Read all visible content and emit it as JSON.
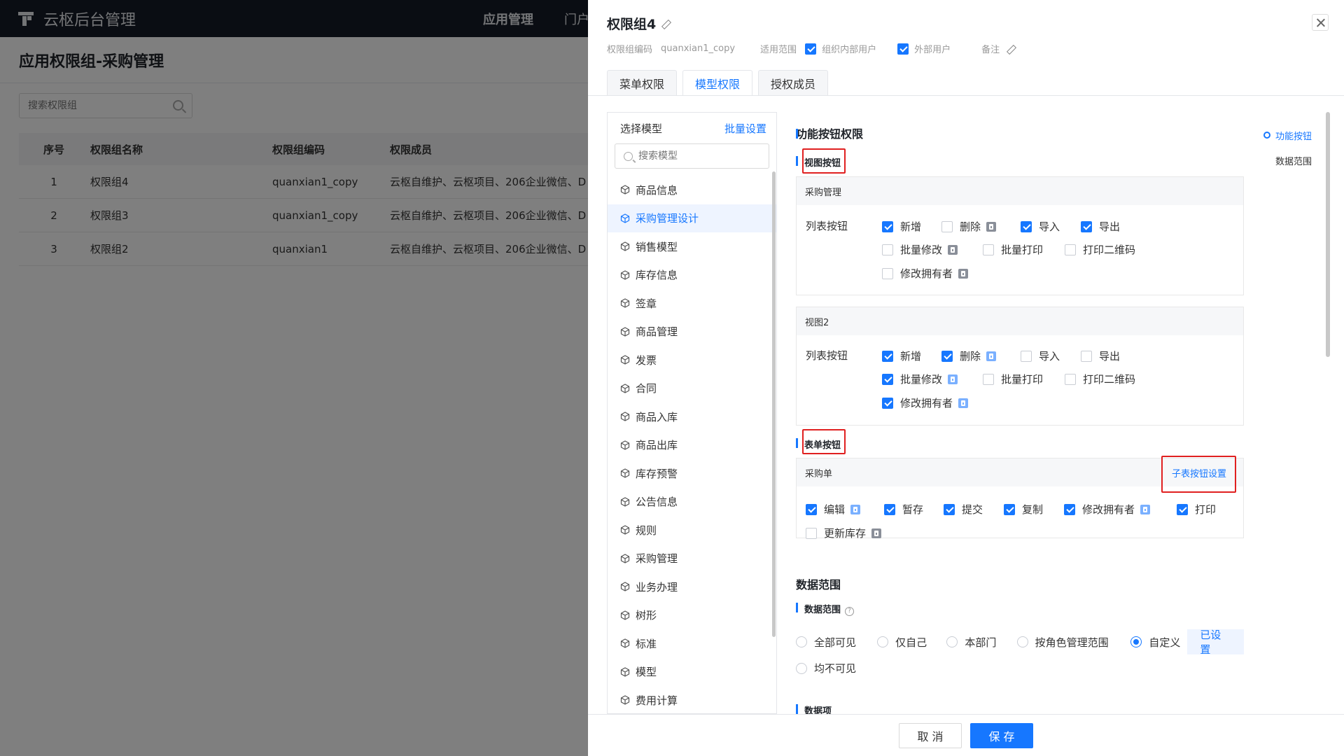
{
  "app": {
    "title": "云枢后台管理",
    "nav": [
      "应用管理",
      "门户"
    ]
  },
  "bg": {
    "page_title": "应用权限组-采购管理",
    "search_placeholder": "搜索权限组",
    "columns": [
      "序号",
      "权限组名称",
      "权限组编码",
      "权限成员"
    ],
    "rows": [
      [
        "1",
        "权限组4",
        "quanxian1_copy",
        "云枢自维护、云枢项目、206企业微信、D"
      ],
      [
        "2",
        "权限组3",
        "quanxian1_copy",
        "云枢自维护、云枢项目、206企业微信、D"
      ],
      [
        "3",
        "权限组2",
        "quanxian1",
        "云枢自维护、云枢项目、206企业微信、D"
      ]
    ]
  },
  "drawer": {
    "title": "权限组4",
    "meta": {
      "code_label": "权限组编码",
      "code_value": "quanxian1_copy",
      "scope_label": "适用范围",
      "scope_inner": "组织内部用户",
      "scope_outer": "外部用户",
      "note_label": "备注"
    },
    "tabs": [
      "菜单权限",
      "模型权限",
      "授权成员"
    ],
    "model_panel": {
      "title": "选择模型",
      "batch": "批量设置",
      "search_placeholder": "搜索模型",
      "items": [
        "商品信息",
        "采购管理设计",
        "销售模型",
        "库存信息",
        "签章",
        "商品管理",
        "发票",
        "合同",
        "商品入库",
        "商品出库",
        "库存预警",
        "公告信息",
        "规则",
        "采购管理",
        "业务办理",
        "树形",
        "标准",
        "模型",
        "费用计算"
      ]
    },
    "func": {
      "title": "功能按钮权限",
      "view_title": "视图按钮",
      "view1": {
        "name": "采购管理",
        "row_label": "列表按钮"
      },
      "view2": {
        "name": "视图2",
        "row_label": "列表按钮"
      },
      "form_title": "表单按钮",
      "form1": {
        "name": "采购单",
        "sub_link": "子表按钮设置"
      },
      "labels": {
        "add": "新增",
        "del": "删除",
        "imp": "导入",
        "exp": "导出",
        "bulk_edit": "批量修改",
        "bulk_print": "批量打印",
        "print_qr": "打印二维码",
        "owner": "修改拥有者",
        "edit": "编辑",
        "draft": "暂存",
        "submit": "提交",
        "copy": "复制",
        "print": "打印",
        "update_stock": "更新库存"
      }
    },
    "data_scope": {
      "title": "数据范围",
      "sub": "数据范围",
      "options": [
        "全部可见",
        "仅自己",
        "本部门",
        "按角色管理范围",
        "自定义"
      ],
      "already": "已设置",
      "none": "均不可见",
      "next": "数据项"
    },
    "anchor": [
      "功能按钮",
      "数据范围"
    ],
    "footer": {
      "cancel": "取 消",
      "save": "保 存"
    }
  }
}
